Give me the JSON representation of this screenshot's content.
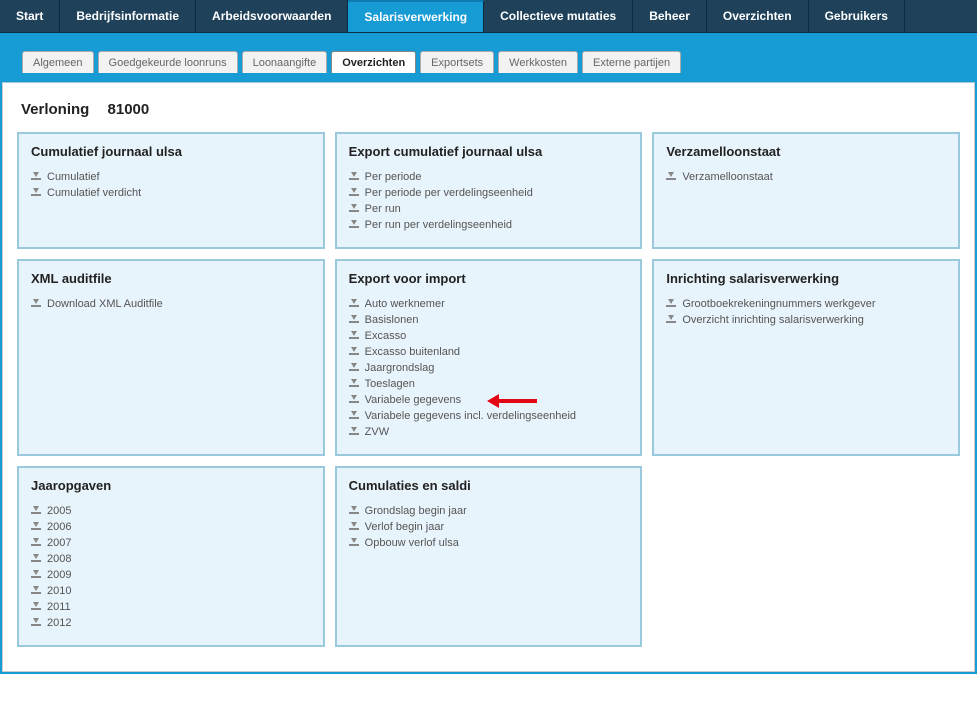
{
  "topnav": [
    {
      "label": "Start",
      "active": false
    },
    {
      "label": "Bedrijfsinformatie",
      "active": false
    },
    {
      "label": "Arbeidsvoorwaarden",
      "active": false
    },
    {
      "label": "Salarisverwerking",
      "active": true
    },
    {
      "label": "Collectieve mutaties",
      "active": false
    },
    {
      "label": "Beheer",
      "active": false
    },
    {
      "label": "Overzichten",
      "active": false
    },
    {
      "label": "Gebruikers",
      "active": false
    }
  ],
  "subtabs": [
    {
      "label": "Algemeen",
      "active": false
    },
    {
      "label": "Goedgekeurde loonruns",
      "active": false
    },
    {
      "label": "Loonaangifte",
      "active": false
    },
    {
      "label": "Overzichten",
      "active": true
    },
    {
      "label": "Exportsets",
      "active": false
    },
    {
      "label": "Werkkosten",
      "active": false
    },
    {
      "label": "Externe partijen",
      "active": false
    }
  ],
  "page": {
    "title": "Verloning",
    "code": "81000"
  },
  "cards": [
    {
      "title": "Cumulatief journaal ulsa",
      "items": [
        "Cumulatief",
        "Cumulatief verdicht"
      ]
    },
    {
      "title": "Export cumulatief journaal ulsa",
      "items": [
        "Per periode",
        "Per periode per verdelingseenheid",
        "Per run",
        "Per run per verdelingseenheid"
      ]
    },
    {
      "title": "Verzamelloonstaat",
      "items": [
        "Verzamelloonstaat"
      ]
    },
    {
      "title": "XML auditfile",
      "items": [
        "Download XML Auditfile"
      ]
    },
    {
      "title": "Export voor import",
      "items": [
        "Auto werknemer",
        "Basislonen",
        "Excasso",
        "Excasso buitenland",
        "Jaargrondslag",
        "Toeslagen",
        "Variabele gegevens",
        "Variabele gegevens incl. verdelingseenheid",
        "ZVW"
      ],
      "arrowOn": 6
    },
    {
      "title": "Inrichting salarisverwerking",
      "items": [
        "Grootboekrekeningnummers werkgever",
        "Overzicht inrichting salarisverwerking"
      ]
    },
    {
      "title": "Jaaropgaven",
      "items": [
        "2005",
        "2006",
        "2007",
        "2008",
        "2009",
        "2010",
        "2011",
        "2012"
      ]
    },
    {
      "title": "Cumulaties en saldi",
      "items": [
        "Grondslag begin jaar",
        "Verlof begin jaar",
        "Opbouw verlof ulsa"
      ]
    }
  ]
}
